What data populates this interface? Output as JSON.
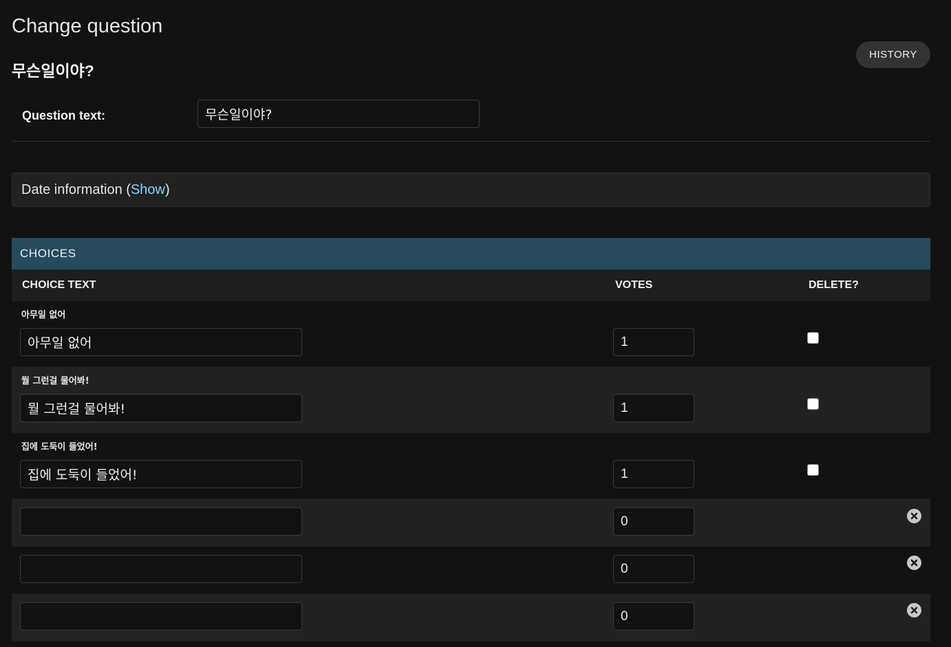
{
  "page": {
    "title": "Change question",
    "object_title": "무슨일이야?",
    "history_label": "HISTORY"
  },
  "question": {
    "label": "Question text:",
    "value": "무슨일이야?"
  },
  "date_fieldset": {
    "label_prefix": "Date information (",
    "show_link": "Show",
    "label_suffix": ")"
  },
  "choices": {
    "title": "CHOICES",
    "columns": {
      "choice_text": "CHOICE TEXT",
      "votes": "VOTES",
      "delete": "DELETE?"
    },
    "existing": [
      {
        "caption": "아무일 없어",
        "text": "아무일 없어",
        "votes": "1",
        "delete": false
      },
      {
        "caption": "뭘 그런걸 물어봐!",
        "text": "뭘 그런걸 물어봐!",
        "votes": "1",
        "delete": false
      },
      {
        "caption": "집에 도둑이 들었어!",
        "text": "집에 도둑이 들었어!",
        "votes": "1",
        "delete": false
      }
    ],
    "extra": [
      {
        "text": "",
        "votes": "0"
      },
      {
        "text": "",
        "votes": "0"
      },
      {
        "text": "",
        "votes": "0"
      }
    ]
  },
  "colors": {
    "background": "#121212",
    "module_header": "#264b5d",
    "link": "#81d4fa"
  }
}
